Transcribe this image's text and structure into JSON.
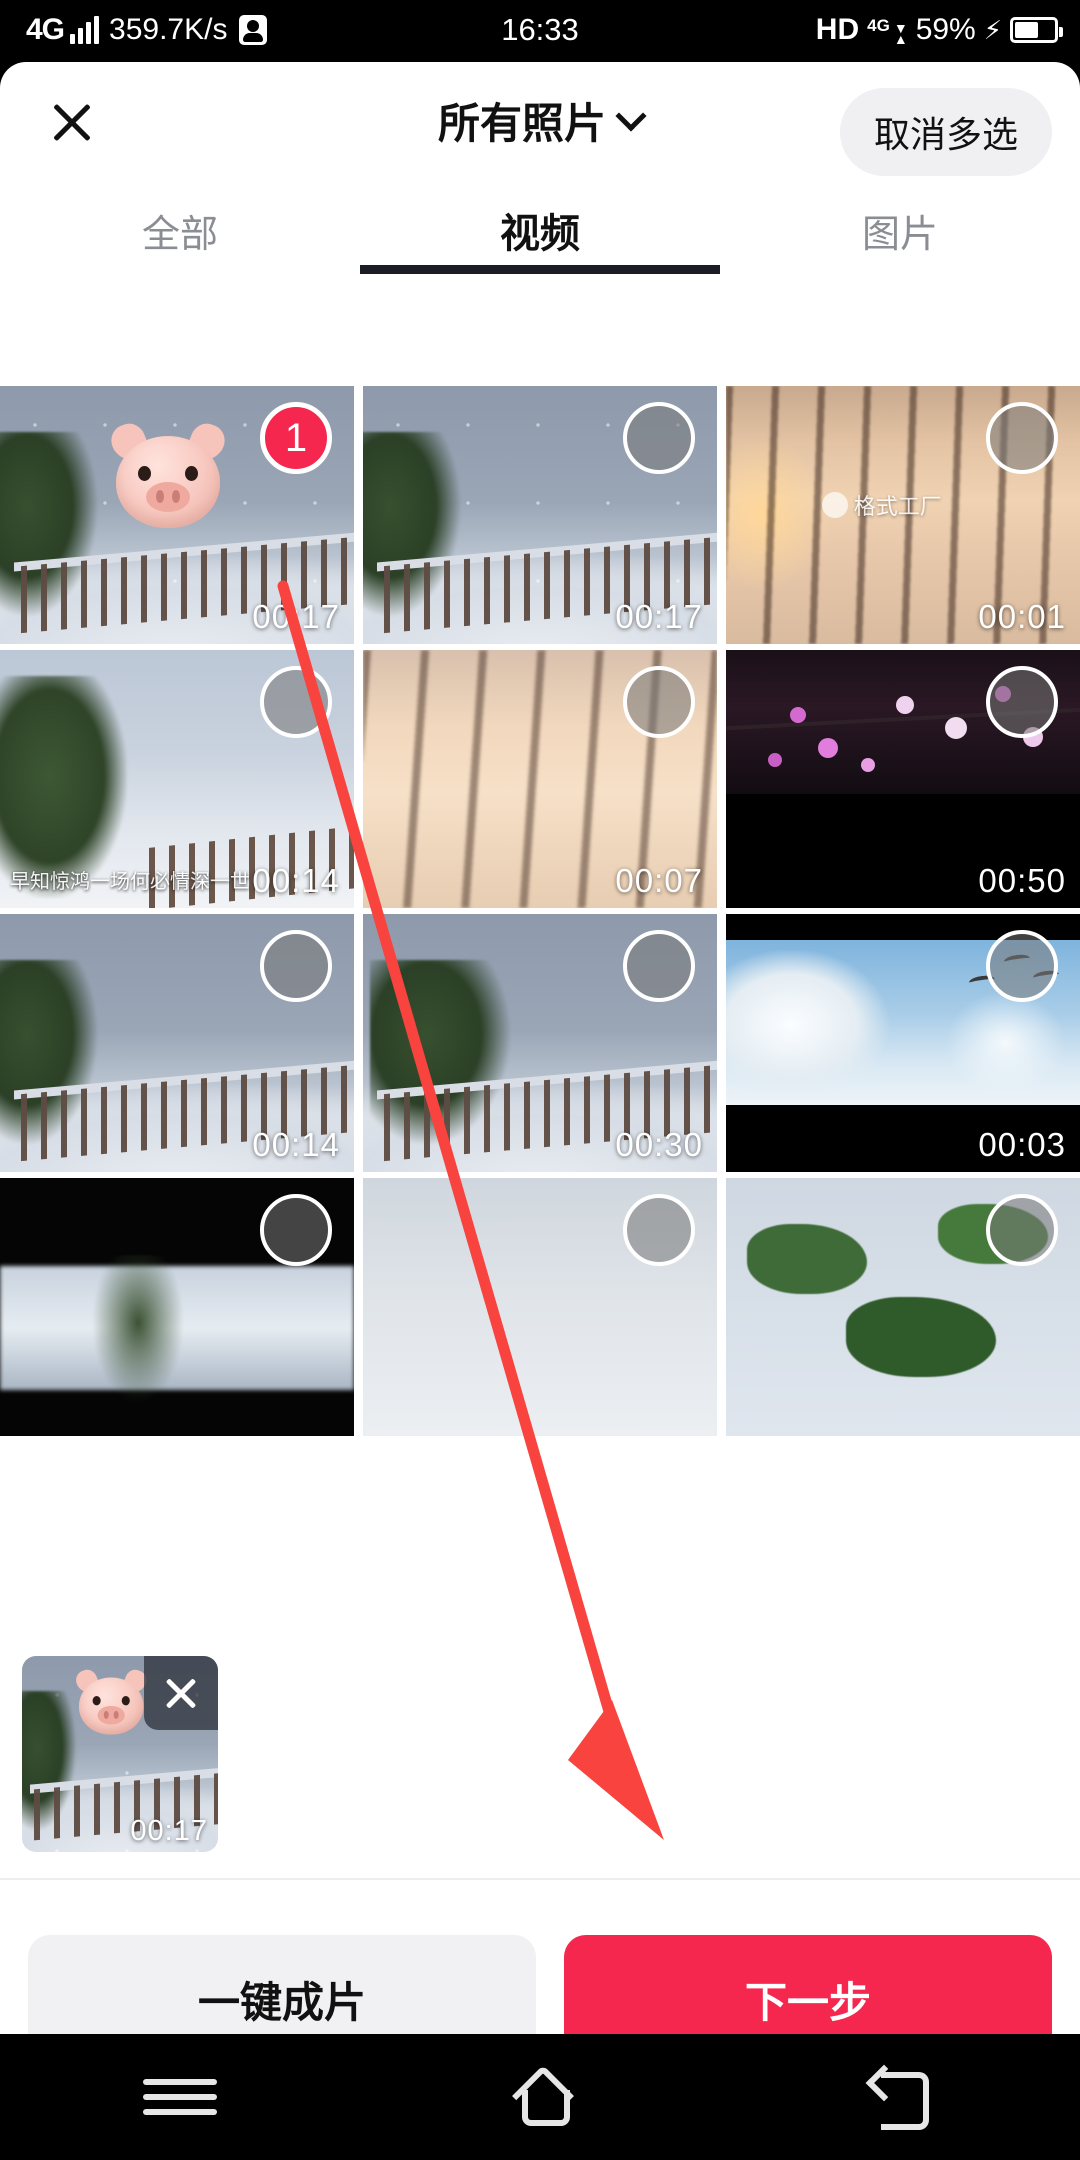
{
  "status_bar": {
    "network_type": "4G",
    "speed": "359.7K/s",
    "time": "16:33",
    "hd": "HD",
    "volte": "4G",
    "battery_percent": "59%"
  },
  "header": {
    "close_icon": "close-icon",
    "title": "所有照片",
    "dropdown_icon": "chevron-down-icon",
    "cancel_multiselect_label": "取消多选"
  },
  "tabs": [
    {
      "label": "全部",
      "active": false
    },
    {
      "label": "视频",
      "active": true
    },
    {
      "label": "图片",
      "active": false
    }
  ],
  "grid": {
    "items": [
      {
        "duration": "00:17",
        "selected": true,
        "badge": "1",
        "scene": "snow-deck",
        "overlay": "pig-emoji"
      },
      {
        "duration": "00:17",
        "selected": false,
        "badge": "",
        "scene": "snow-deck",
        "overlay": ""
      },
      {
        "duration": "00:01",
        "selected": false,
        "badge": "",
        "scene": "sunset",
        "overlay": "watermark",
        "watermark": "格式工厂"
      },
      {
        "duration": "00:14",
        "selected": false,
        "badge": "",
        "scene": "tree-wide",
        "overlay": "caption",
        "caption": "早知惊鸿一场何必情深一世"
      },
      {
        "duration": "00:07",
        "selected": false,
        "badge": "",
        "scene": "sunset2",
        "overlay": ""
      },
      {
        "duration": "00:50",
        "selected": false,
        "badge": "",
        "scene": "blossom",
        "overlay": ""
      },
      {
        "duration": "00:14",
        "selected": false,
        "badge": "",
        "scene": "snow-deck",
        "overlay": ""
      },
      {
        "duration": "00:30",
        "selected": false,
        "badge": "",
        "scene": "green-snow",
        "overlay": ""
      },
      {
        "duration": "00:03",
        "selected": false,
        "badge": "",
        "scene": "geese",
        "overlay": ""
      },
      {
        "duration": "",
        "selected": false,
        "badge": "",
        "scene": "dark",
        "overlay": ""
      },
      {
        "duration": "",
        "selected": false,
        "badge": "",
        "scene": "sky",
        "overlay": ""
      },
      {
        "duration": "",
        "selected": false,
        "badge": "",
        "scene": "green-snow",
        "overlay": ""
      }
    ]
  },
  "tray": {
    "selected_item": {
      "duration": "00:17",
      "remove_icon": "close-icon",
      "overlay": "pig-emoji"
    }
  },
  "actions": {
    "auto_compose_label": "一键成片",
    "next_label": "下一步"
  },
  "navbar": {
    "menu_icon": "menu-icon",
    "home_icon": "home-icon",
    "back_icon": "back-icon"
  },
  "annotation": {
    "arrow_color": "#F8433E",
    "from": "selected-thumbnail",
    "to": "next-button"
  },
  "colors": {
    "accent_red": "#F5274E",
    "arrow_red": "#F8433E",
    "sheet_bg": "#FFFFFF",
    "chip_bg": "#F0F0F2",
    "tab_inactive": "#8A8D93",
    "tab_active": "#111111"
  }
}
